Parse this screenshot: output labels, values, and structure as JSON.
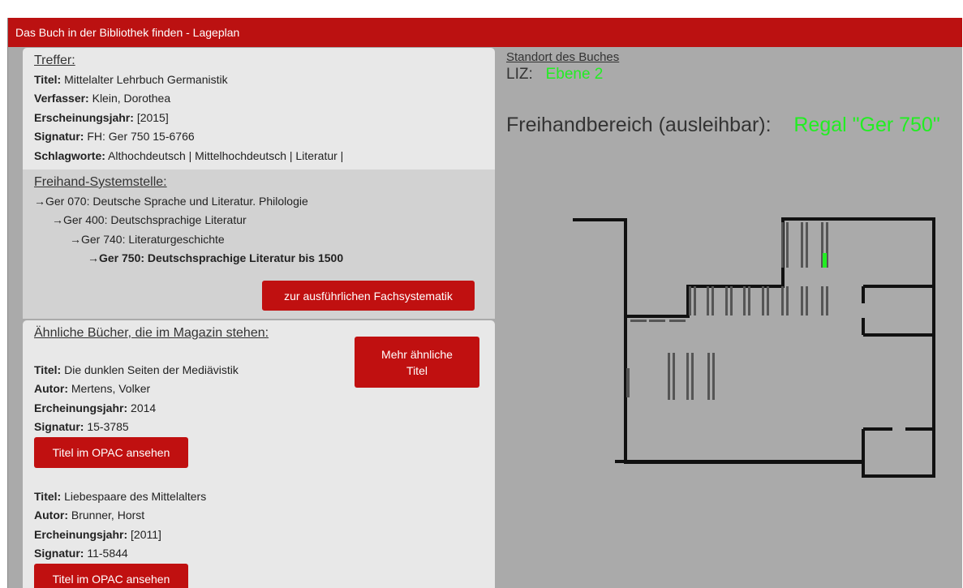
{
  "header": {
    "title": "Das Buch in der Bibliothek finden - Lageplan"
  },
  "treffer": {
    "heading": "Treffer:",
    "fields": [
      {
        "label": "Titel:",
        "value": "Mittelalter Lehrbuch Germanistik"
      },
      {
        "label": "Verfasser:",
        "value": "Klein, Dorothea"
      },
      {
        "label": "Erscheinungsjahr:",
        "value": "[2015]"
      },
      {
        "label": "Signatur:",
        "value": "FH: Ger 750 15-6766"
      },
      {
        "label": "Schlagworte:",
        "value": "Althochdeutsch | Mittelhochdeutsch | Literatur |"
      }
    ]
  },
  "freihand": {
    "heading": "Freihand-Systemstelle:",
    "tree": [
      "→Ger 070: Deutsche Sprache und Literatur. Philologie",
      "→Ger 400: Deutschsprachige Literatur",
      "→Ger 740: Literaturgeschichte",
      "→Ger 750: Deutschsprachige Literatur bis 1500"
    ],
    "button": "zur ausführlichen Fachsystematik"
  },
  "similar": {
    "heading": "Ähnliche Bücher, die im Magazin stehen:",
    "more_button": "Mehr ähnliche Titel",
    "books": [
      {
        "title_label": "Titel:",
        "title": "Die dunklen Seiten der Mediävistik",
        "author_label": "Autor:",
        "author": "Mertens, Volker",
        "year_label": "Ercheinungsjahr:",
        "year": "2014",
        "sig_label": "Signatur:",
        "sig": "15-3785",
        "button": "Titel im OPAC ansehen"
      },
      {
        "title_label": "Titel:",
        "title": "Liebespaare des Mittelalters",
        "author_label": "Autor:",
        "author": "Brunner, Horst",
        "year_label": "Ercheinungsjahr:",
        "year": "[2011]",
        "sig_label": "Signatur:",
        "sig": "11-5844",
        "button": "Titel im OPAC ansehen"
      }
    ]
  },
  "location": {
    "heading": "Standort des Buches",
    "building": "LIZ:",
    "level": "Ebene 2",
    "area": "Freihandbereich (ausleihbar):",
    "shelf": "Regal \"Ger 750\""
  },
  "colors": {
    "accent": "#bb1111",
    "highlight": "#22ee22"
  }
}
